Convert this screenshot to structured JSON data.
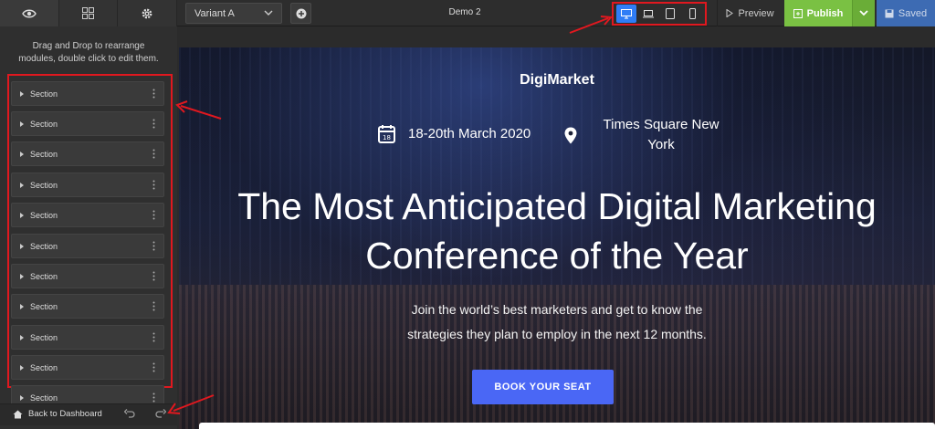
{
  "toolbar": {
    "sidebar_tabs": [
      {
        "icon": "eye-icon",
        "active": true
      },
      {
        "icon": "grid-icon",
        "active": false
      },
      {
        "icon": "gear-icon",
        "active": false
      }
    ],
    "variant": "Variant A",
    "document_title": "Demo 2",
    "devices": [
      {
        "icon": "desktop-icon",
        "active": true
      },
      {
        "icon": "laptop-icon",
        "active": false
      },
      {
        "icon": "tablet-icon",
        "active": false
      },
      {
        "icon": "mobile-icon",
        "active": false
      }
    ],
    "preview_label": "Preview",
    "publish_label": "Publish",
    "saved_label": "Saved"
  },
  "sidebar": {
    "hint": "Drag and Drop to rearrange modules, double click to edit them.",
    "sections": [
      "Section",
      "Section",
      "Section",
      "Section",
      "Section",
      "Section",
      "Section",
      "Section",
      "Section",
      "Section",
      "Section"
    ],
    "back_label": "Back to Dashboard"
  },
  "page": {
    "brand": "DigiMarket",
    "date": "18-20th March 2020",
    "location": "Times Square New York",
    "headline": "The Most Anticipated Digital Marketing Conference of the Year",
    "subhead_line1": "Join the world’s best marketers and get to know the",
    "subhead_line2": "strategies they plan to employ in the next 12 months.",
    "cta": "BOOK YOUR SEAT"
  },
  "colors": {
    "publish": "#7ac143",
    "saved": "#3d6bb3",
    "device_active": "#2f7df6",
    "cta": "#4a67f5",
    "highlight": "#e0181f"
  }
}
